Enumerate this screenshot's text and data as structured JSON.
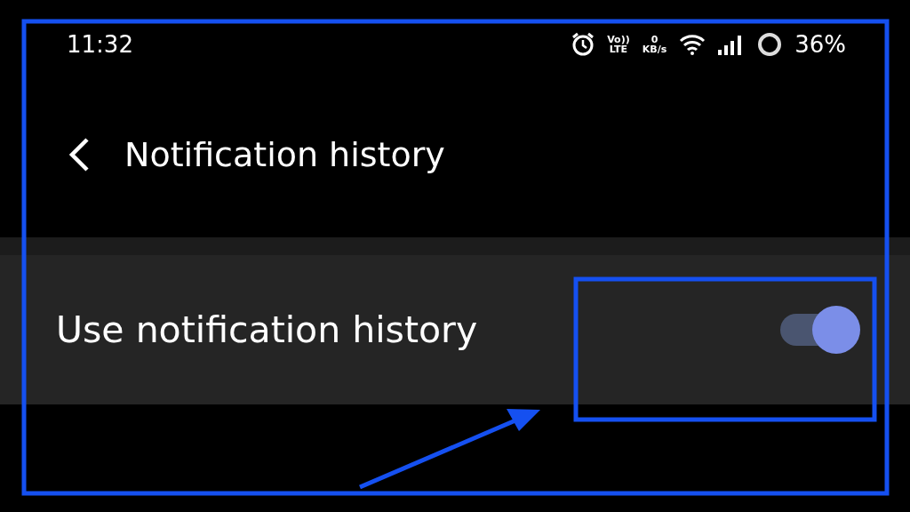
{
  "status_bar": {
    "time": "11:32",
    "volte": [
      "Vo))",
      "LTE"
    ],
    "speed": [
      "0",
      "KB/s"
    ],
    "battery": "36%"
  },
  "header": {
    "title": "Notification history"
  },
  "settings": [
    {
      "kind": "switch",
      "label": "Use notification history",
      "on": true
    }
  ]
}
